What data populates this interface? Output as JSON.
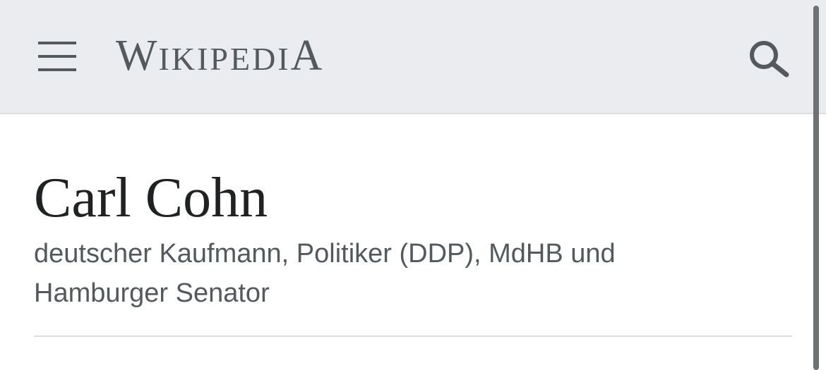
{
  "header": {
    "logo_parts": [
      "W",
      "IKIPEDI",
      "A"
    ],
    "menu_icon": "hamburger-menu-icon",
    "search_icon": "search-icon"
  },
  "article": {
    "title": "Carl Cohn",
    "description": "deutscher Kaufmann, Politiker (DDP), MdHB und Hamburger Senator"
  },
  "colors": {
    "header_bg": "#eaecf0",
    "icon": "#54595d",
    "title": "#202122",
    "subtitle": "#54595d"
  }
}
